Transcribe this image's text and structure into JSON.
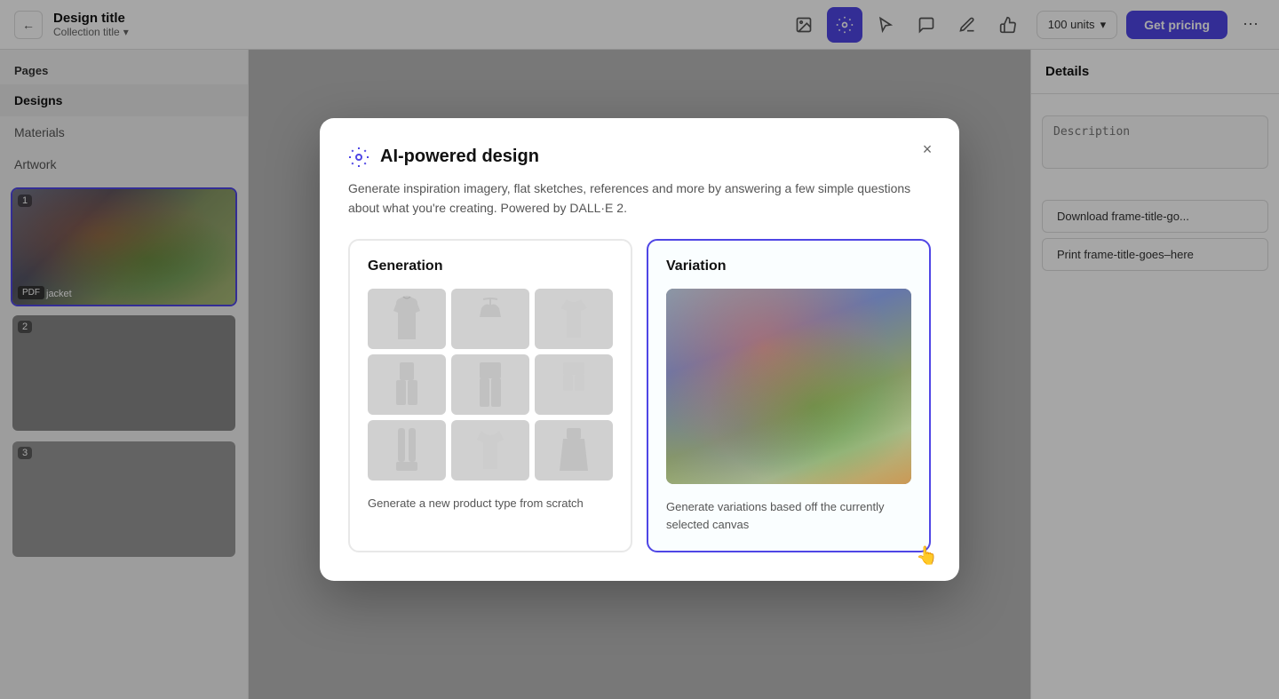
{
  "header": {
    "back_label": "←",
    "design_title": "Design title",
    "collection_title": "Collection title",
    "collection_dropdown": "▾",
    "tools": [
      {
        "id": "photo",
        "icon": "🖼",
        "active": false,
        "label": "photo-tool"
      },
      {
        "id": "gear",
        "icon": "⚙",
        "active": true,
        "label": "gear-tool"
      },
      {
        "id": "cursor",
        "icon": "↗",
        "active": false,
        "label": "cursor-tool"
      },
      {
        "id": "comment",
        "icon": "💬",
        "active": false,
        "label": "comment-tool"
      },
      {
        "id": "pen",
        "icon": "✏",
        "active": false,
        "label": "pen-tool"
      },
      {
        "id": "thumb",
        "icon": "👍",
        "active": false,
        "label": "thumb-tool"
      }
    ],
    "units_label": "100 units",
    "get_pricing_label": "Get pricing",
    "more_icon": "⋯"
  },
  "sidebar": {
    "section_title": "Pages",
    "nav_items": [
      {
        "label": "Designs",
        "active": true
      },
      {
        "label": "Materials",
        "active": false
      },
      {
        "label": "Artwork",
        "active": false
      }
    ],
    "designs": [
      {
        "num": "1",
        "badge": "PDF",
        "label": "jacket",
        "selected": true
      },
      {
        "num": "2",
        "badge": "",
        "label": "",
        "selected": false
      },
      {
        "num": "3",
        "badge": "",
        "label": "",
        "selected": false
      }
    ]
  },
  "right_panel": {
    "title": "Details",
    "description_placeholder": "Description",
    "actions": [
      "Download frame-title-go...",
      "Print frame-title-goes–here"
    ]
  },
  "modal": {
    "title": "AI-powered design",
    "description": "Generate inspiration imagery, flat sketches, references and more by answering a few simple questions about what you're creating. Powered by DALL·E 2.",
    "close_label": "×",
    "generation_card": {
      "title": "Generation",
      "description": "Generate a new product type from scratch"
    },
    "variation_card": {
      "title": "Variation",
      "description": "Generate variations based off the currently selected canvas"
    }
  }
}
